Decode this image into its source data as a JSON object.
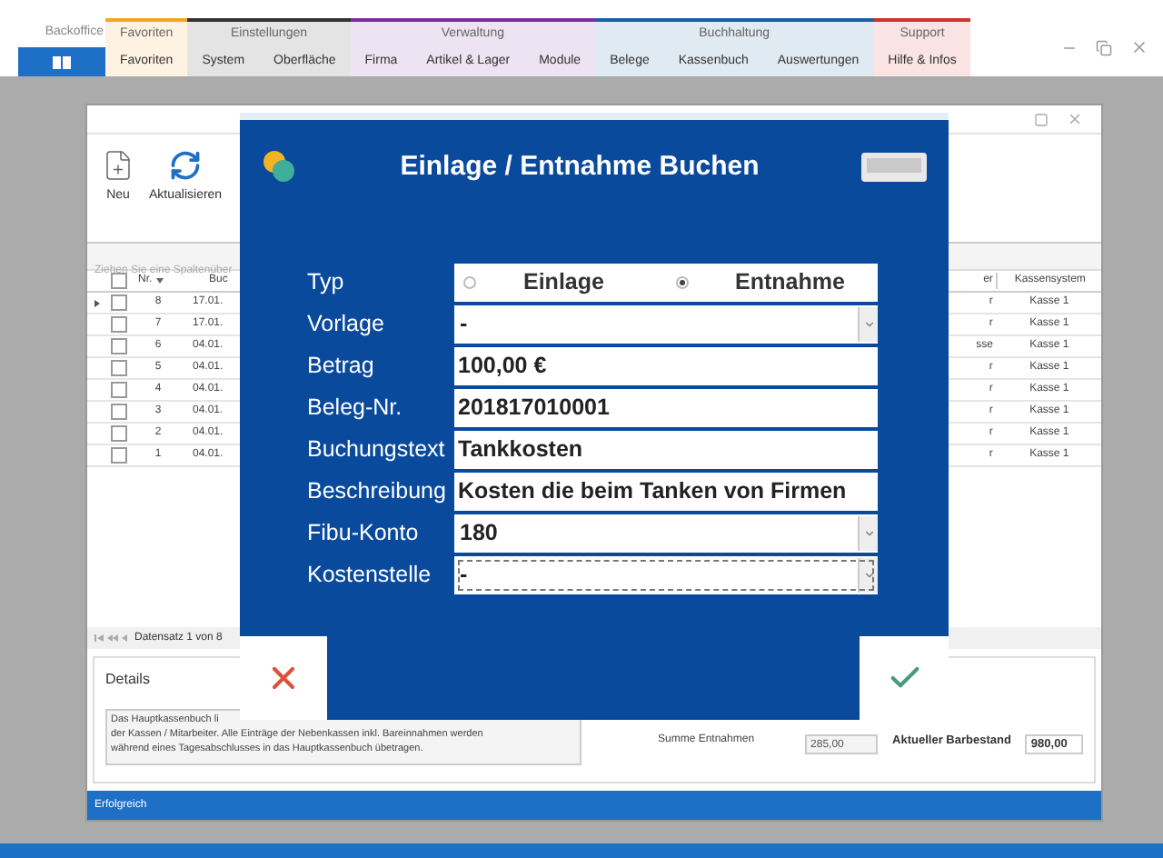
{
  "ribbon": {
    "app_label": "Backoffice",
    "groups": [
      {
        "title": "Favoriten",
        "color": "#f5a623",
        "tabs": [
          "Favoriten"
        ]
      },
      {
        "title": "Einstellungen",
        "color": "#333333",
        "tabs": [
          "System",
          "Oberfläche"
        ]
      },
      {
        "title": "Verwaltung",
        "color": "#7b2fa0",
        "tabs": [
          "Firma",
          "Artikel & Lager",
          "Module"
        ]
      },
      {
        "title": "Buchhaltung",
        "color": "#1a5fa8",
        "tabs": [
          "Belege",
          "Kassenbuch",
          "Auswertungen"
        ]
      },
      {
        "title": "Support",
        "color": "#d0312d",
        "tabs": [
          "Hilfe & Infos"
        ]
      }
    ]
  },
  "window": {
    "toolbar": [
      {
        "label": "Neu",
        "kind": "new"
      },
      {
        "label": "Aktualisieren",
        "kind": "refresh"
      }
    ],
    "group_hint": "Ziehen Sie eine Spaltenüber",
    "header_checked": false,
    "columns": {
      "nr": "Nr.",
      "date": "Buc",
      "column_6": "er",
      "system": "Kassensystem"
    },
    "rows": [
      {
        "nr": "8",
        "date": "17.01.",
        "column_6": "r",
        "system": "Kasse 1",
        "current": true,
        "checked": false
      },
      {
        "nr": "7",
        "date": "17.01.",
        "column_6": "r",
        "system": "Kasse 1",
        "current": false,
        "checked": false
      },
      {
        "nr": "6",
        "date": "04.01.",
        "column_6": "sse",
        "system": "Kasse 1",
        "current": false,
        "checked": false
      },
      {
        "nr": "5",
        "date": "04.01.",
        "column_6": "r",
        "system": "Kasse 1",
        "current": false,
        "checked": false
      },
      {
        "nr": "4",
        "date": "04.01.",
        "column_6": "r",
        "system": "Kasse 1",
        "current": false,
        "checked": false
      },
      {
        "nr": "3",
        "date": "04.01.",
        "column_6": "r",
        "system": "Kasse 1",
        "current": false,
        "checked": false
      },
      {
        "nr": "2",
        "date": "04.01.",
        "column_6": "r",
        "system": "Kasse 1",
        "current": false,
        "checked": false
      },
      {
        "nr": "1",
        "date": "04.01.",
        "column_6": "r",
        "system": "Kasse 1",
        "current": false,
        "checked": false
      }
    ],
    "navigator": "Datensatz 1 von 8",
    "details": {
      "title": "Details",
      "text_lines": [
        "Das Hauptkassenbuch li",
        "der Kassen / Mitarbeiter. Alle Einträge der Nebenkassen inkl. Bareinnahmen werden",
        "während eines Tagesabschlusses in das Hauptkassenbuch übetragen."
      ],
      "sum_label": "Summe Entnahmen",
      "sum_value": "285,00",
      "balance_label": "Aktueller Barbestand",
      "balance_value": "980,00"
    },
    "status_bar": "Erfolgreich"
  },
  "dialog": {
    "title": "Einlage / Entnahme Buchen",
    "fields": [
      {
        "label": "Typ",
        "kind": "radio",
        "options": [
          {
            "label": "Einlage",
            "selected": false
          },
          {
            "label": "Entnahme",
            "selected": true
          }
        ]
      },
      {
        "label": "Vorlage",
        "kind": "select",
        "value": "-",
        "focused": false
      },
      {
        "label": "Betrag",
        "kind": "text",
        "value": "100,00 €"
      },
      {
        "label": "Beleg-Nr.",
        "kind": "text",
        "value": "201817010001"
      },
      {
        "label": "Buchungstext",
        "kind": "text",
        "value": "Tankkosten"
      },
      {
        "label": "Beschreibung",
        "kind": "text",
        "value": "Kosten die beim Tanken von Firmen"
      },
      {
        "label": "Fibu-Konto",
        "kind": "select",
        "value": "180",
        "focused": false
      },
      {
        "label": "Kostenstelle",
        "kind": "select",
        "value": "-",
        "focused": true
      }
    ]
  }
}
